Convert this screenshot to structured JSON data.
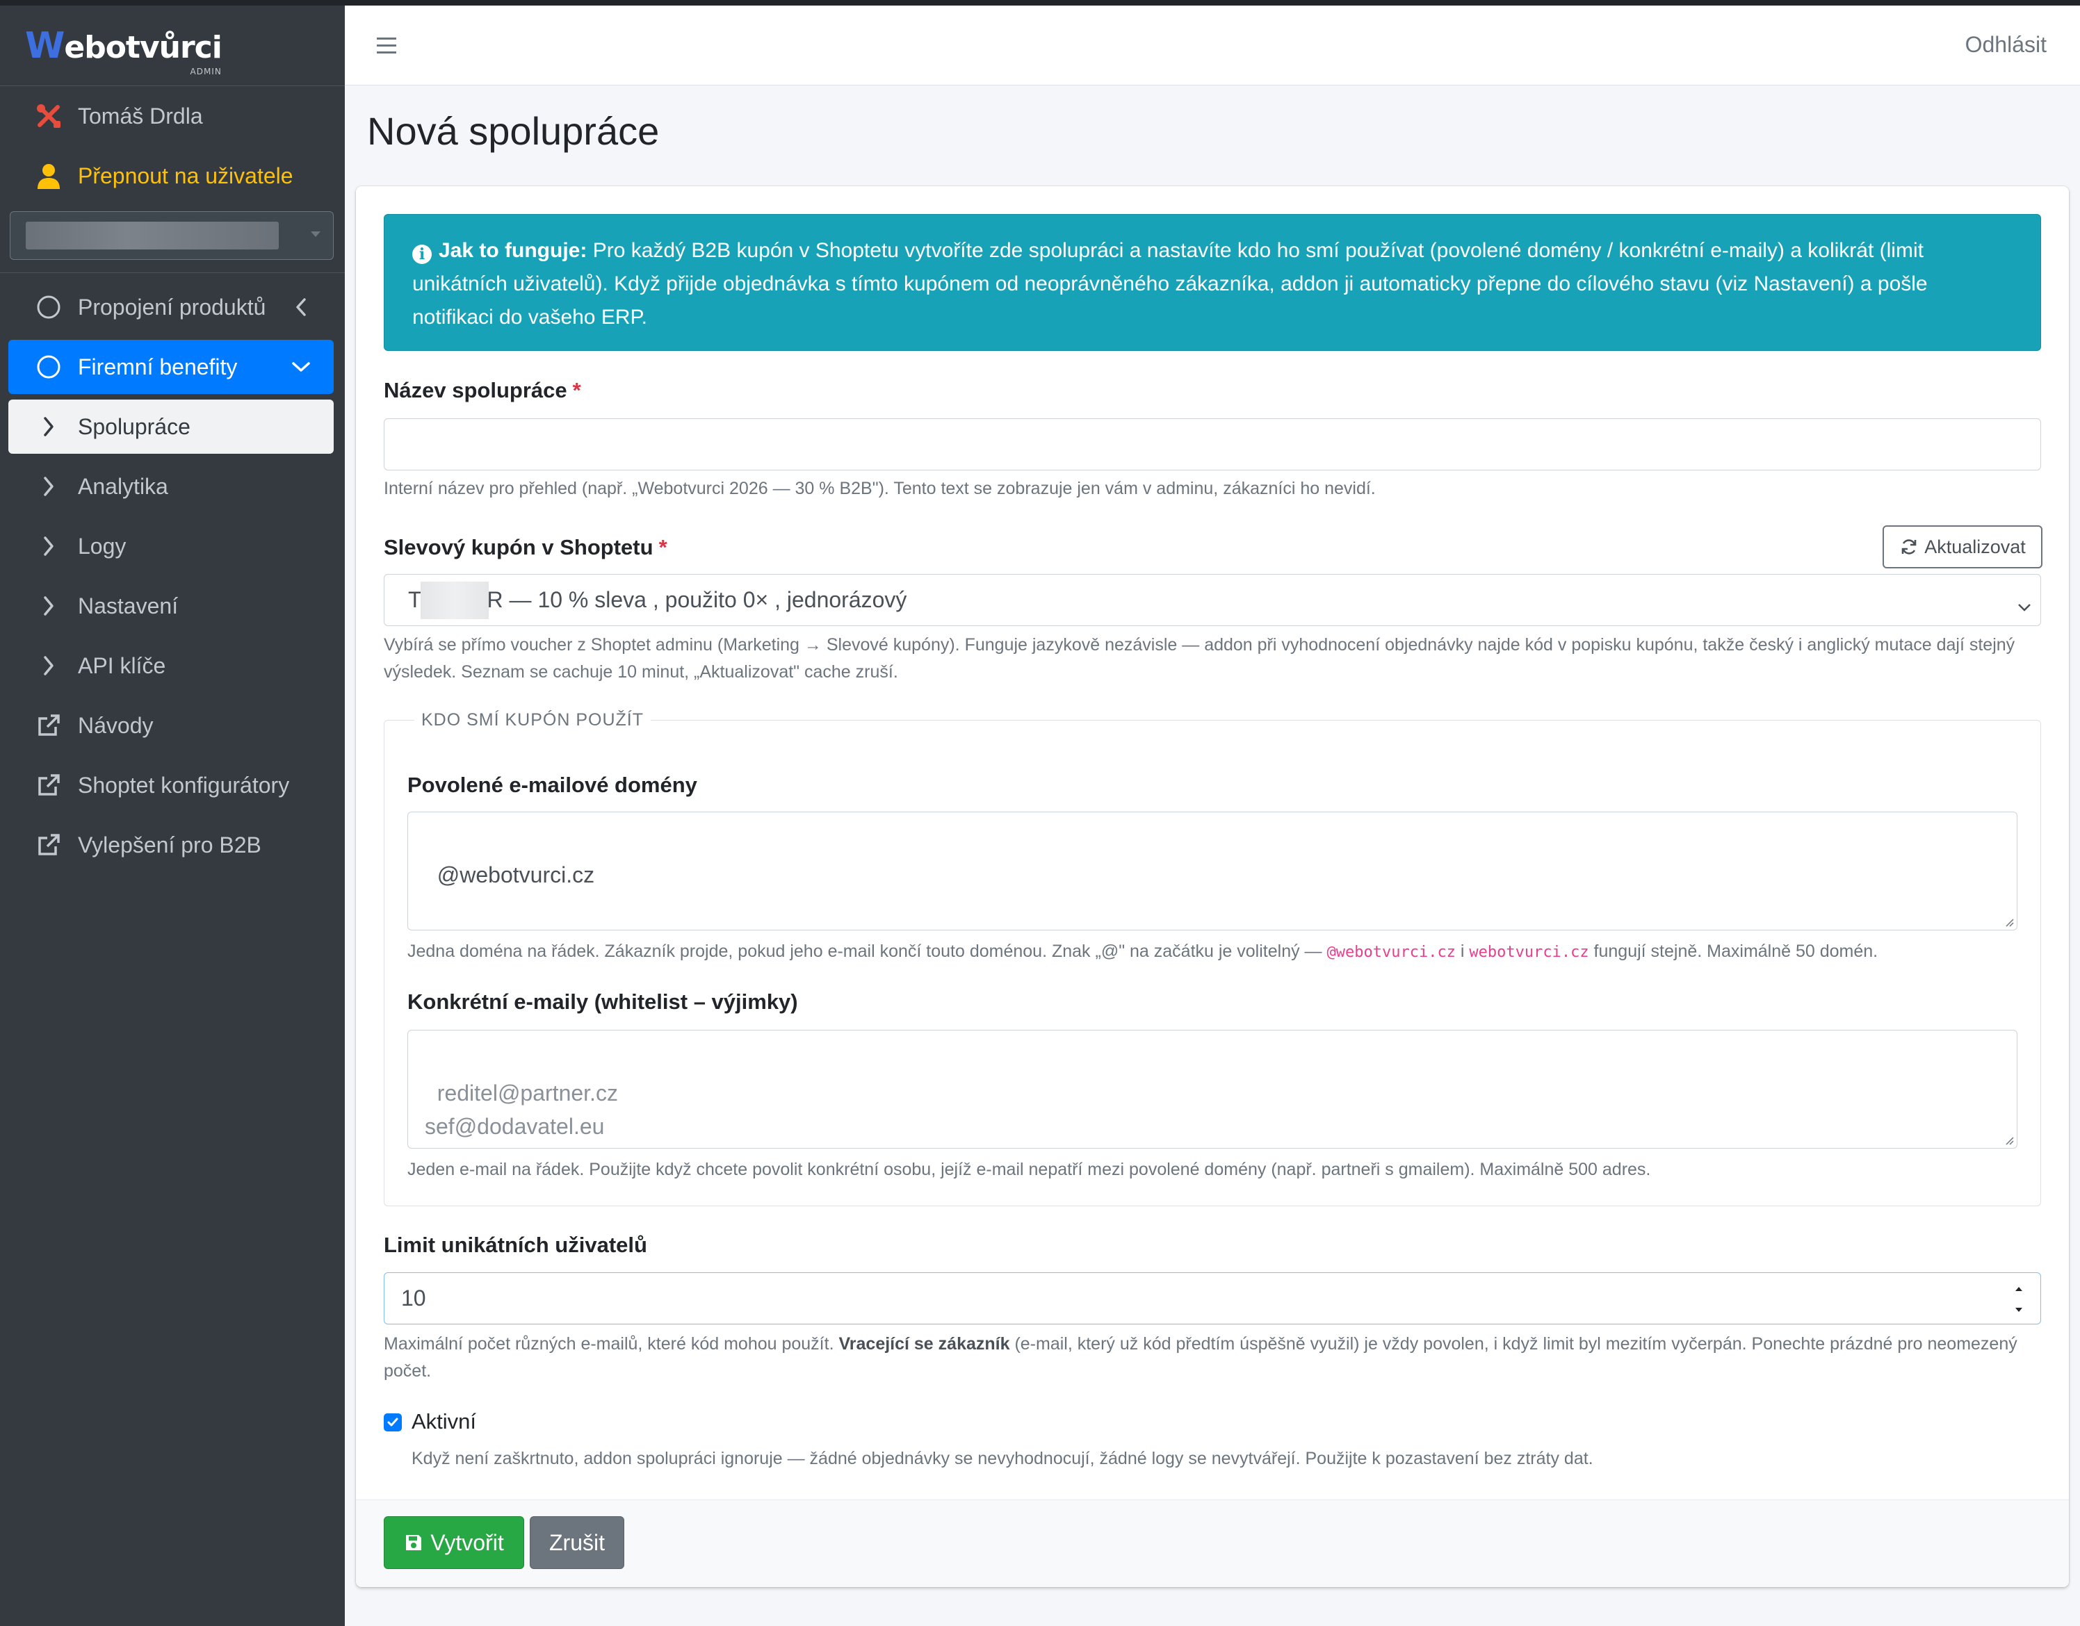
{
  "brand": {
    "logo_text": "ebotvůrci",
    "logo_letter": "W",
    "sub": "ADMIN"
  },
  "sidebar": {
    "user_name": "Tomáš Drdla",
    "switch_user": "Přepnout na uživatele",
    "items": [
      {
        "label": "Propojení produktů",
        "icon": "circle-icon"
      },
      {
        "label": "Firemní benefity",
        "icon": "circle-icon"
      },
      {
        "label": "Spolupráce",
        "icon": "chevron-right-icon"
      },
      {
        "label": "Analytika",
        "icon": "chevron-right-icon"
      },
      {
        "label": "Logy",
        "icon": "chevron-right-icon"
      },
      {
        "label": "Nastavení",
        "icon": "chevron-right-icon"
      },
      {
        "label": "API klíče",
        "icon": "chevron-right-icon"
      },
      {
        "label": "Návody",
        "icon": "external-link-icon"
      },
      {
        "label": "Shoptet konfigurátory",
        "icon": "external-link-icon"
      },
      {
        "label": "Vylepšení pro B2B",
        "icon": "external-link-icon"
      }
    ]
  },
  "topbar": {
    "logout": "Odhlásit"
  },
  "page": {
    "title": "Nová spolupráce"
  },
  "alert": {
    "lead": "Jak to funguje:",
    "text": "Pro každý B2B kupón v Shoptetu vytvoříte zde spolupráci a nastavíte kdo ho smí používat (povolené domény / konkrétní e-maily) a kolikrát (limit unikátních uživatelů). Když přijde objednávka s tímto kupónem od neoprávněného zákazníka, addon ji automaticky přepne do cílového stavu (viz Nastavení) a pošle notifikaci do vašeho ERP."
  },
  "form": {
    "name": {
      "label": "Název spolupráce",
      "required": "*",
      "value": "",
      "help": "Interní název pro přehled (např. „Webotvurci 2026 — 30 % B2B\"). Tento text se zobrazuje jen vám v adminu, zákazníci ho nevidí."
    },
    "coupon": {
      "label": "Slevový kupón v Shoptetu",
      "required": "*",
      "refresh_label": "Aktualizovat",
      "value_prefix": "T",
      "value_suffix": "R — 10 % sleva , použito 0× , jednorázový",
      "help": "Vybírá se přímo voucher z Shoptet adminu (Marketing → Slevové kupóny). Funguje jazykově nezávisle — addon při vyhodnocení objednávky najde kód v popisku kupónu, takže český i anglický mutace dají stejný výsledek. Seznam se cachuje 10 minut, „Aktualizovat\" cache zruší."
    },
    "fieldset_legend": "KDO SMÍ KUPÓN POUŽÍT",
    "domains": {
      "label": "Povolené e-mailové domény",
      "value": "@webotvurci.cz",
      "help_a": "Jedna doména na řádek. Zákazník projde, pokud jeho e-mail končí touto doménou. Znak „@\" na začátku je volitelný —",
      "code_1": "@webotvurci.cz",
      "help_b": "i",
      "code_2": "webotvurci.cz",
      "help_c": "fungují stejně. Maximálně 50 domén."
    },
    "emails": {
      "label": "Konkrétní e-maily (whitelist – výjimky)",
      "placeholder": "reditel@partner.cz\nsef@dodavatel.eu",
      "help": "Jeden e-mail na řádek. Použijte když chcete povolit konkrétní osobu, jejíž e-mail nepatří mezi povolené domény (např. partneři s gmailem). Maximálně 500 adres."
    },
    "limit": {
      "label": "Limit unikátních uživatelů",
      "value": "10",
      "help_a": "Maximální počet různých e-mailů, které kód mohou použít.",
      "help_bold": "Vracející se zákazník",
      "help_b": "(e-mail, který už kód předtím úspěšně využil) je vždy povolen, i když limit byl mezitím vyčerpán. Ponechte prázdné pro neomezený počet."
    },
    "active": {
      "label": "Aktivní",
      "checked": true,
      "help": "Když není zaškrtnuto, addon spolupráci ignoruje — žádné objednávky se nevyhodnocují, žádné logy se nevytvářejí. Použijte k pozastavení bez ztráty dat."
    },
    "submit_label": "Vytvořit",
    "cancel_label": "Zrušit"
  },
  "colors": {
    "primary": "#007bff",
    "info": "#17a2b8",
    "success": "#28a745",
    "secondary": "#6c757d",
    "sidebar": "#343a40",
    "warning": "#ffc107"
  }
}
